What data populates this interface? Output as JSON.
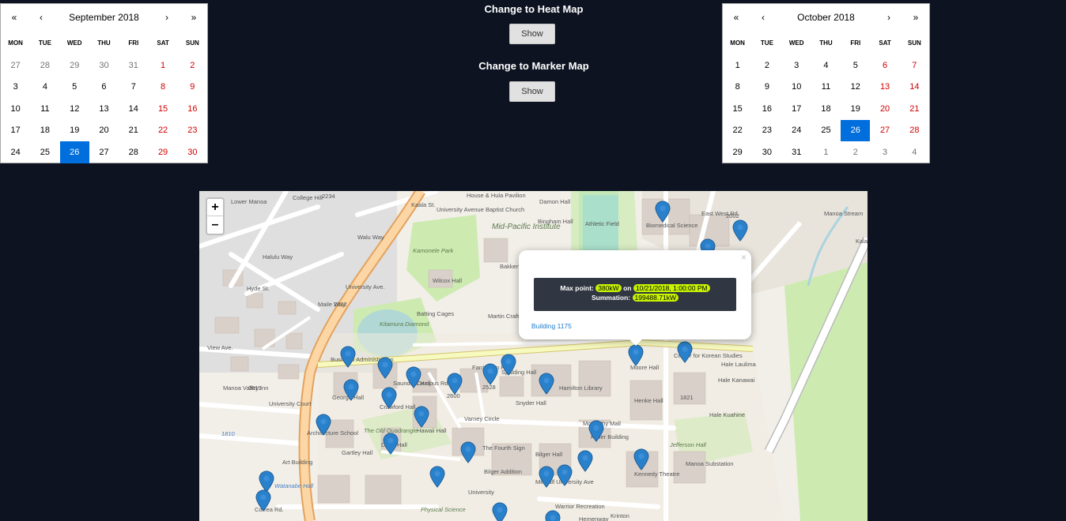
{
  "calendar_left": {
    "nav": {
      "prev_year": "«",
      "prev_month": "‹",
      "next_month": "›",
      "next_year": "»"
    },
    "month_label": "September 2018",
    "weekdays": [
      "MON",
      "TUE",
      "WED",
      "THU",
      "FRI",
      "SAT",
      "SUN"
    ],
    "days": [
      {
        "d": "27",
        "t": "out"
      },
      {
        "d": "28",
        "t": "out"
      },
      {
        "d": "29",
        "t": "out"
      },
      {
        "d": "30",
        "t": "out"
      },
      {
        "d": "31",
        "t": "out"
      },
      {
        "d": "1",
        "t": "wk"
      },
      {
        "d": "2",
        "t": "wk"
      },
      {
        "d": "3",
        "t": ""
      },
      {
        "d": "4",
        "t": ""
      },
      {
        "d": "5",
        "t": ""
      },
      {
        "d": "6",
        "t": ""
      },
      {
        "d": "7",
        "t": ""
      },
      {
        "d": "8",
        "t": "wk"
      },
      {
        "d": "9",
        "t": "wk"
      },
      {
        "d": "10",
        "t": ""
      },
      {
        "d": "11",
        "t": ""
      },
      {
        "d": "12",
        "t": ""
      },
      {
        "d": "13",
        "t": ""
      },
      {
        "d": "14",
        "t": ""
      },
      {
        "d": "15",
        "t": "wk"
      },
      {
        "d": "16",
        "t": "wk"
      },
      {
        "d": "17",
        "t": ""
      },
      {
        "d": "18",
        "t": ""
      },
      {
        "d": "19",
        "t": ""
      },
      {
        "d": "20",
        "t": ""
      },
      {
        "d": "21",
        "t": ""
      },
      {
        "d": "22",
        "t": "wk"
      },
      {
        "d": "23",
        "t": "wk"
      },
      {
        "d": "24",
        "t": ""
      },
      {
        "d": "25",
        "t": ""
      },
      {
        "d": "26",
        "t": "sel"
      },
      {
        "d": "27",
        "t": ""
      },
      {
        "d": "28",
        "t": ""
      },
      {
        "d": "29",
        "t": "wk"
      },
      {
        "d": "30",
        "t": "wk"
      }
    ]
  },
  "calendar_right": {
    "nav": {
      "prev_year": "«",
      "prev_month": "‹",
      "next_month": "›",
      "next_year": "»"
    },
    "month_label": "October 2018",
    "weekdays": [
      "MON",
      "TUE",
      "WED",
      "THU",
      "FRI",
      "SAT",
      "SUN"
    ],
    "days": [
      {
        "d": "1",
        "t": ""
      },
      {
        "d": "2",
        "t": ""
      },
      {
        "d": "3",
        "t": ""
      },
      {
        "d": "4",
        "t": ""
      },
      {
        "d": "5",
        "t": ""
      },
      {
        "d": "6",
        "t": "wk"
      },
      {
        "d": "7",
        "t": "wk"
      },
      {
        "d": "8",
        "t": ""
      },
      {
        "d": "9",
        "t": ""
      },
      {
        "d": "10",
        "t": ""
      },
      {
        "d": "11",
        "t": ""
      },
      {
        "d": "12",
        "t": ""
      },
      {
        "d": "13",
        "t": "wk"
      },
      {
        "d": "14",
        "t": "wk"
      },
      {
        "d": "15",
        "t": ""
      },
      {
        "d": "16",
        "t": ""
      },
      {
        "d": "17",
        "t": ""
      },
      {
        "d": "18",
        "t": ""
      },
      {
        "d": "19",
        "t": ""
      },
      {
        "d": "20",
        "t": "wk"
      },
      {
        "d": "21",
        "t": "wk"
      },
      {
        "d": "22",
        "t": ""
      },
      {
        "d": "23",
        "t": ""
      },
      {
        "d": "24",
        "t": ""
      },
      {
        "d": "25",
        "t": ""
      },
      {
        "d": "26",
        "t": "sel"
      },
      {
        "d": "27",
        "t": "wk"
      },
      {
        "d": "28",
        "t": "wk"
      },
      {
        "d": "29",
        "t": ""
      },
      {
        "d": "30",
        "t": ""
      },
      {
        "d": "31",
        "t": ""
      },
      {
        "d": "1",
        "t": "out"
      },
      {
        "d": "2",
        "t": "out"
      },
      {
        "d": "3",
        "t": "out"
      },
      {
        "d": "4",
        "t": "out"
      }
    ]
  },
  "controls": {
    "heat_title": "Change to Heat Map",
    "heat_button": "Show",
    "marker_title": "Change to Marker Map",
    "marker_button": "Show"
  },
  "map": {
    "zoom_in": "+",
    "zoom_out": "–",
    "popup": {
      "close": "×",
      "max_label": "Max point:",
      "max_value": "380kW",
      "on_label": "on",
      "max_date": "10/21/2018, 1:00:00 PM",
      "sum_label": "Summation:",
      "sum_value": "199488.71kW",
      "link": "Building 1175"
    },
    "labels": [
      "Lower Manoa",
      "College Hill",
      "2234",
      "Kaala St.",
      "University Avenue Baptist Church",
      "House & Hula Pavilion",
      "Damon Hall",
      "Bingham Hall",
      "Athletic Field",
      "Biomedical Science",
      "East West Rd.",
      "2002",
      "Manoa Stream",
      "Kalanianaole",
      "Mid-Pacific Institute",
      "Kamonele Park",
      "Walu Way",
      "Halulu Way",
      "Hyde St.",
      "Maile Way",
      "2322",
      "University Ave.",
      "Wilcox Hall",
      "Kitamura Diamond",
      "Batting Cages",
      "Bakken Auditorium",
      "Martin Craft Shop",
      "Business Administration",
      "Saunders Hall",
      "Spalding Hall",
      "Hamilton Library",
      "Center for Korean Studies",
      "Hale Laulima",
      "Hale Kanawai",
      "Hale Kuahine",
      "Henke Hall",
      "1821",
      "George Hall",
      "Crawford Hall",
      "Campus Rd.",
      "2600",
      "2528",
      "Farrington Rd.",
      "Snyder Hall",
      "Moore Hall",
      "Hawaii Hall",
      "Varney Circle",
      "McCarthy Mall",
      "Keller Building",
      "Manoa Valley Inn",
      "2019",
      "University Court",
      "Architecture School",
      "The Old Quadrangle",
      "Dean Hall",
      "Gartley Hall",
      "The Fourth Sign",
      "Bilger Hall",
      "Kennedy Theatre",
      "Jefferson Hall",
      "Manoa Substation",
      "1810",
      "Art Building",
      "Bilger Addition",
      "Metcalf University Ave",
      "Watanabe Hall",
      "Correa Rd.",
      "Warrior Recreation",
      "Physical Science",
      "University",
      "Krinton",
      "Hemenway",
      "View Ave."
    ]
  }
}
